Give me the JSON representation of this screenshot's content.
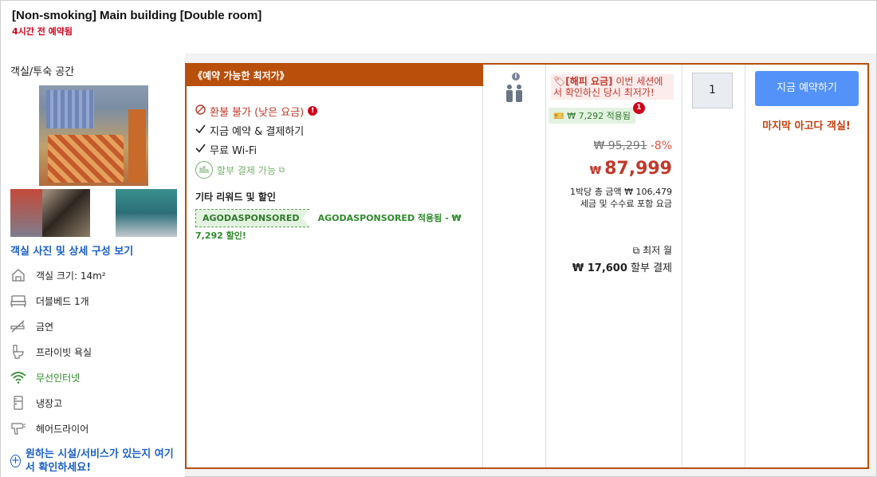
{
  "header": {
    "room_title": "[Non-smoking] Main building [Double room]",
    "booked_text": "4시간 전 예약됨"
  },
  "left": {
    "section_title": "객실/투숙 공간",
    "see_photos": "객실 사진 및 상세 구성 보기",
    "amenities": [
      {
        "icon": "house-icon",
        "label": "객실 크기: 14m²"
      },
      {
        "icon": "bed-icon",
        "label": "더블베드 1개"
      },
      {
        "icon": "no-smoking-icon",
        "label": "금연"
      },
      {
        "icon": "toilet-icon",
        "label": "프라이빗 욕실"
      },
      {
        "icon": "wifi-icon",
        "label": "무선인터넷"
      },
      {
        "icon": "fridge-icon",
        "label": "냉장고"
      },
      {
        "icon": "hairdryer-icon",
        "label": "헤어드라이어"
      }
    ],
    "facility_question": "원하는 시설/서비스가 있는지 여기서 확인하세요!"
  },
  "offer": {
    "ribbon": "《예약 가능한 최저가》",
    "conditions": {
      "non_refundable": "환불 불가 (낮은 요금)",
      "book_now_pay": "지금 예약 & 결제하기",
      "wifi": "무료 Wi-Fi",
      "installment": "할부 결제 가능"
    },
    "misc_title": "기타 리워드 및 할인",
    "promo_tag": "AGODASPONSORED",
    "promo_text": "AGODASPONSORED 적용됨 - ₩ 7,292 할인!",
    "occupancy_info": "i",
    "deal_label": "[해피 요금]",
    "deal_text": " 이번 세션에서 확인하신 당시 최저가!",
    "applied_text": "₩ 7,292 적용됨",
    "applied_badge": "1",
    "original_price": "₩ 95,291",
    "discount_pct": "-8%",
    "price_currency": "₩",
    "price": "87,999",
    "total_line1": "1박당 총 금액 ₩ 106,479",
    "total_line2": "세금 및 수수료 포함 요금",
    "monthly_label": "최저 월",
    "installment_amount": "₩ 17,600",
    "installment_suffix": " 할부 결제",
    "quantity": "1",
    "book_button": "지금 예약하기",
    "last_room": "마지막 아고다 객실!"
  },
  "colors": {
    "accent_orange": "#b84f0a",
    "price_red": "#c0392b",
    "button_blue": "#5392f9",
    "promo_green": "#2e7a2b"
  }
}
